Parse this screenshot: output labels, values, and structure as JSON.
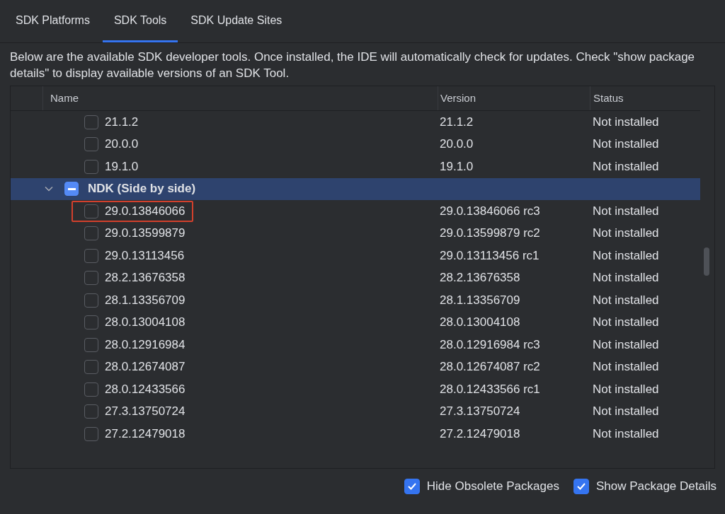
{
  "tabs": [
    {
      "label": "SDK Platforms",
      "selected": false
    },
    {
      "label": "SDK Tools",
      "selected": true
    },
    {
      "label": "SDK Update Sites",
      "selected": false
    }
  ],
  "description": "Below are the available SDK developer tools. Once installed, the IDE will automatically check for updates. Check \"show package details\" to display available versions of an SDK Tool.",
  "table": {
    "columns": [
      "Name",
      "Version",
      "Status"
    ],
    "rows": [
      {
        "kind": "item",
        "name": "21.1.2",
        "version": "21.1.2",
        "status": "Not installed",
        "checked": false,
        "selected": false,
        "annotated": false
      },
      {
        "kind": "item",
        "name": "20.0.0",
        "version": "20.0.0",
        "status": "Not installed",
        "checked": false,
        "selected": false,
        "annotated": false
      },
      {
        "kind": "item",
        "name": "19.1.0",
        "version": "19.1.0",
        "status": "Not installed",
        "checked": false,
        "selected": false,
        "annotated": false
      },
      {
        "kind": "group",
        "name": "NDK (Side by side)",
        "indeterminate": true,
        "expanded": true,
        "selected": true
      },
      {
        "kind": "item",
        "name": "29.0.13846066",
        "version": "29.0.13846066 rc3",
        "status": "Not installed",
        "checked": false,
        "selected": false,
        "annotated": true
      },
      {
        "kind": "item",
        "name": "29.0.13599879",
        "version": "29.0.13599879 rc2",
        "status": "Not installed",
        "checked": false,
        "selected": false,
        "annotated": false
      },
      {
        "kind": "item",
        "name": "29.0.13113456",
        "version": "29.0.13113456 rc1",
        "status": "Not installed",
        "checked": false,
        "selected": false,
        "annotated": false
      },
      {
        "kind": "item",
        "name": "28.2.13676358",
        "version": "28.2.13676358",
        "status": "Not installed",
        "checked": false,
        "selected": false,
        "annotated": false
      },
      {
        "kind": "item",
        "name": "28.1.13356709",
        "version": "28.1.13356709",
        "status": "Not installed",
        "checked": false,
        "selected": false,
        "annotated": false
      },
      {
        "kind": "item",
        "name": "28.0.13004108",
        "version": "28.0.13004108",
        "status": "Not installed",
        "checked": false,
        "selected": false,
        "annotated": false
      },
      {
        "kind": "item",
        "name": "28.0.12916984",
        "version": "28.0.12916984 rc3",
        "status": "Not installed",
        "checked": false,
        "selected": false,
        "annotated": false
      },
      {
        "kind": "item",
        "name": "28.0.12674087",
        "version": "28.0.12674087 rc2",
        "status": "Not installed",
        "checked": false,
        "selected": false,
        "annotated": false
      },
      {
        "kind": "item",
        "name": "28.0.12433566",
        "version": "28.0.12433566 rc1",
        "status": "Not installed",
        "checked": false,
        "selected": false,
        "annotated": false
      },
      {
        "kind": "item",
        "name": "27.3.13750724",
        "version": "27.3.13750724",
        "status": "Not installed",
        "checked": false,
        "selected": false,
        "annotated": false
      },
      {
        "kind": "item",
        "name": "27.2.12479018",
        "version": "27.2.12479018",
        "status": "Not installed",
        "checked": false,
        "selected": false,
        "annotated": false
      }
    ]
  },
  "options": [
    {
      "label": "Hide Obsolete Packages",
      "checked": true
    },
    {
      "label": "Show Package Details",
      "checked": true
    }
  ]
}
